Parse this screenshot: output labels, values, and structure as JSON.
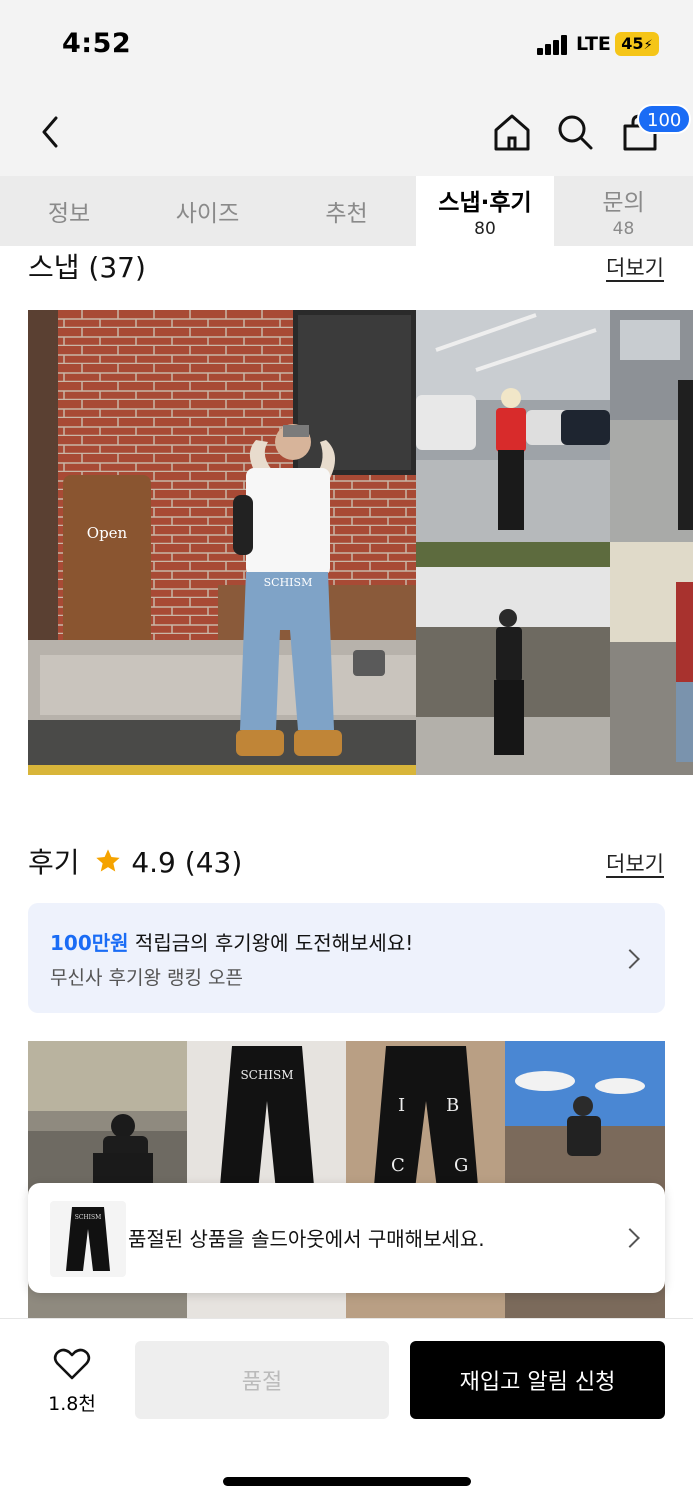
{
  "status_bar": {
    "time": "4:52",
    "network": "LTE",
    "battery": "45"
  },
  "header": {
    "back_icon": "chevron-left-icon",
    "home_icon": "home-icon",
    "search_icon": "search-icon",
    "cart_icon": "shopping-bag-icon",
    "cart_count": "100"
  },
  "tabs": [
    {
      "label": "정보",
      "count": ""
    },
    {
      "label": "사이즈",
      "count": ""
    },
    {
      "label": "추천",
      "count": ""
    },
    {
      "label": "스냅·후기",
      "count": "80",
      "active": true
    },
    {
      "label": "문의",
      "count": "48"
    }
  ],
  "snap": {
    "title": "스냅 (37)",
    "more": "더보기"
  },
  "reviews": {
    "title": "후기",
    "rating": "4.9",
    "count": "(43)",
    "more": "더보기",
    "promo": {
      "highlight": "100만원",
      "line1": " 적립금의 후기왕에 도전해보세요!",
      "line2": "무신사 후기왕 랭킹 오픈"
    }
  },
  "soldout_popup": {
    "text": "품절된 상품을 솔드아웃에서 구매해보세요."
  },
  "bottom_bar": {
    "likes": "1.8천",
    "soldout_label": "품절",
    "restock_label": "재입고 알림 신청"
  },
  "colors": {
    "accent": "#1a6cf5",
    "star": "#f5a300",
    "promo_bg": "#eef2fc"
  }
}
